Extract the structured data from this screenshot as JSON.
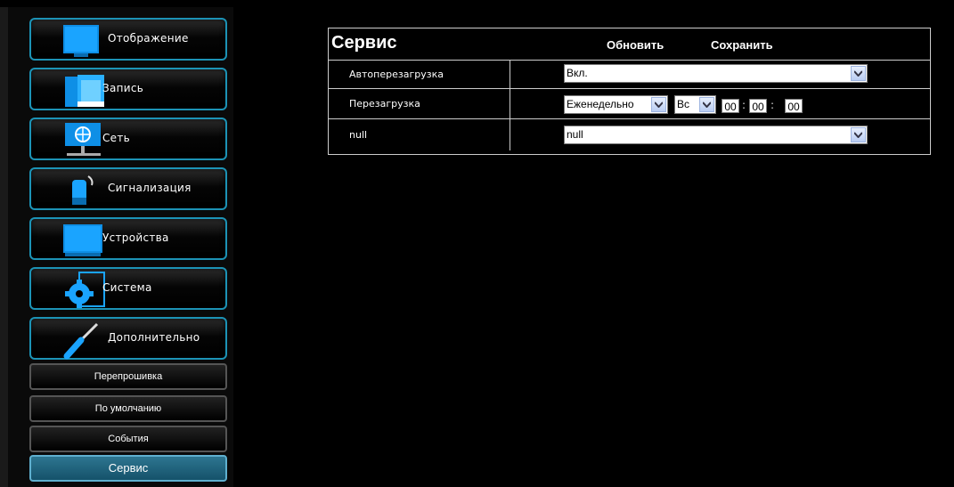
{
  "sidebar": {
    "items": [
      {
        "label": "Отображение",
        "icon": "monitor-icon"
      },
      {
        "label": "Запись",
        "icon": "film-recording-icon"
      },
      {
        "label": "Сеть",
        "icon": "network-globe-icon"
      },
      {
        "label": "Сигнализация",
        "icon": "alarm-siren-icon"
      },
      {
        "label": "Устройства",
        "icon": "device-monitor-icon"
      },
      {
        "label": "Система",
        "icon": "gear-icon"
      },
      {
        "label": "Дополнительно",
        "icon": "screwdriver-icon"
      }
    ],
    "subitems": [
      {
        "label": "Перепрошивка"
      },
      {
        "label": "По умолчанию"
      },
      {
        "label": "События"
      },
      {
        "label": "Сервис",
        "active": true
      }
    ]
  },
  "panel": {
    "title": "Сервис",
    "refresh_label": "Обновить",
    "save_label": "Сохранить",
    "rows": [
      {
        "label": "Автоперезагрузка",
        "value": "Вкл."
      },
      {
        "label": "Перезагрузка",
        "period": "Еженедельно",
        "day": "Вс",
        "hour": "00",
        "minute": "00",
        "second": "00"
      },
      {
        "label": "null",
        "value": "null"
      }
    ]
  },
  "colors": {
    "accent": "#1c93b6",
    "active": "#2d7590",
    "background": "#000000"
  }
}
